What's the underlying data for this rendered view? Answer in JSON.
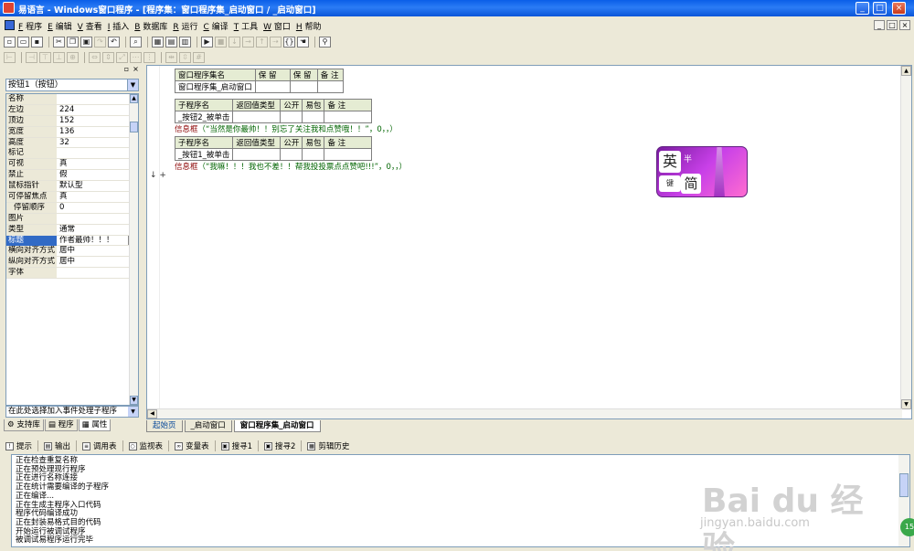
{
  "titlebar": {
    "title": "易语言 - Windows窗口程序 - [程序集：窗口程序集_启动窗口 / _启动窗口]",
    "minimize": "_",
    "maximize": "□",
    "close": "×"
  },
  "menubar": {
    "items": [
      {
        "key": "F",
        "label": "程序"
      },
      {
        "key": "E",
        "label": "编辑"
      },
      {
        "key": "V",
        "label": "查看"
      },
      {
        "key": "I",
        "label": "插入"
      },
      {
        "key": "B",
        "label": "数据库"
      },
      {
        "key": "R",
        "label": "运行"
      },
      {
        "key": "C",
        "label": "编译"
      },
      {
        "key": "T",
        "label": "工具"
      },
      {
        "key": "W",
        "label": "窗口"
      },
      {
        "key": "H",
        "label": "帮助"
      }
    ],
    "mdi_min": "_",
    "mdi_restore": "□",
    "mdi_close": "×"
  },
  "properties": {
    "selected_component": "按钮1（按钮）",
    "rows": [
      {
        "key": "名称",
        "value": ""
      },
      {
        "key": "左边",
        "value": "224"
      },
      {
        "key": "顶边",
        "value": "152"
      },
      {
        "key": "宽度",
        "value": "136"
      },
      {
        "key": "高度",
        "value": "32"
      },
      {
        "key": "标记",
        "value": ""
      },
      {
        "key": "可视",
        "value": "真"
      },
      {
        "key": "禁止",
        "value": "假"
      },
      {
        "key": "鼠标指针",
        "value": "默认型"
      },
      {
        "key": "可停留焦点",
        "value": "真"
      },
      {
        "key": "停留顺序",
        "value": "0"
      },
      {
        "key": "图片",
        "value": ""
      },
      {
        "key": "类型",
        "value": "通常"
      },
      {
        "key": "标题",
        "value": "作者最帅！！！"
      },
      {
        "key": "横向对齐方式",
        "value": "居中"
      },
      {
        "key": "纵向对齐方式",
        "value": "居中"
      },
      {
        "key": "字体",
        "value": ""
      }
    ],
    "event_placeholder": "在此处选择加入事件处理子程序",
    "tabs": [
      "支持库",
      "程序",
      "属性"
    ]
  },
  "editor": {
    "assembly_header": [
      "窗口程序集名",
      "保 留",
      "保 留",
      "备 注"
    ],
    "assembly_name": "窗口程序集_启动窗口",
    "sub_header": [
      "子程序名",
      "返回值类型",
      "公开",
      "易包",
      "备 注"
    ],
    "sub1_name": "_按钮2_被单击",
    "sub1_code_fn": "信息框",
    "sub1_code_args": "（“当然是你最帅！！别忘了关注我和点赞哦！！”，0，，）",
    "sub2_name": "_按钮1_被单击",
    "sub2_code_fn": "信息框",
    "sub2_code_args": "（“我嘛！！！我也不差！！帮我投投票点点赞吧!!!”，0，，）",
    "line_markers": "↓ +",
    "tabs": [
      "起始页",
      "_启动窗口",
      "窗口程序集_启动窗口"
    ]
  },
  "ime": {
    "char1": "英",
    "char2": "半",
    "char3": "键",
    "char4": "简"
  },
  "output": {
    "tabs": [
      "提示",
      "输出",
      "调用表",
      "监视表",
      "变量表",
      "搜寻1",
      "搜寻2",
      "剪辑历史"
    ],
    "lines": [
      "正在检查重复名称",
      "正在预处理现行程序",
      "正在进行名称连接",
      "正在统计需要编译的子程序",
      "正在编译...",
      "正在生成主程序入口代码",
      "程序代码编译成功",
      "正在封装易格式目的代码",
      "开始运行被调试程序",
      "被调试易程序运行完毕"
    ]
  },
  "watermark": {
    "big": "Bai du 经验",
    "small": "jingyan.baidu.com"
  },
  "badge": "15"
}
